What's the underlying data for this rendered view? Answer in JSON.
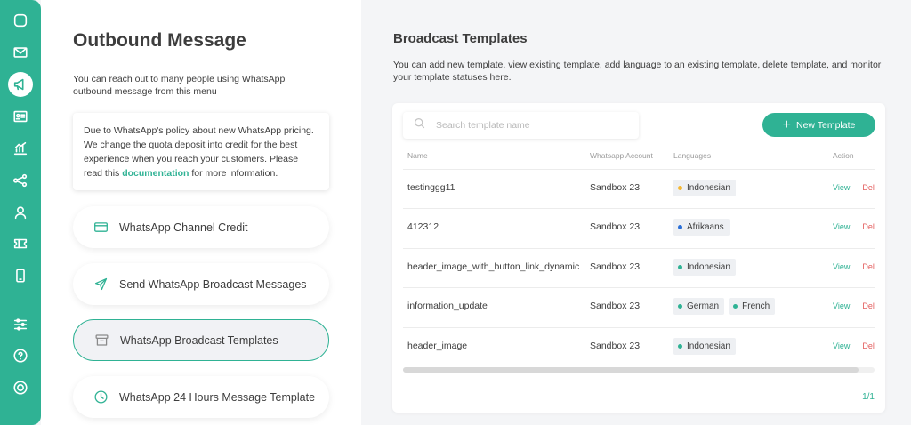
{
  "sidebar": {
    "icons": [
      "chat-icon",
      "mail-icon",
      "megaphone-icon",
      "contact-card-icon",
      "chart-icon",
      "share-icon",
      "user-icon",
      "ticket-icon",
      "mobile-icon",
      "sliders-icon",
      "help-icon",
      "power-icon"
    ],
    "active": "megaphone-icon"
  },
  "left": {
    "title": "Outbound Message",
    "description": "You can reach out to many people using WhatsApp outbound message from this menu",
    "notice_text": "Due to WhatsApp's policy about new WhatsApp pricing. We change the quota deposit into credit for the best experience when you reach your customers. Please read this ",
    "notice_link": "documentation",
    "notice_tail": " for more information.",
    "menu": [
      {
        "label": "WhatsApp Channel Credit",
        "icon": "credit-card-icon"
      },
      {
        "label": "Send WhatsApp Broadcast Messages",
        "icon": "send-icon"
      },
      {
        "label": "WhatsApp Broadcast Templates",
        "icon": "archive-icon",
        "selected": true
      },
      {
        "label": "WhatsApp 24 Hours Message Template",
        "icon": "clock-icon"
      }
    ]
  },
  "right": {
    "title": "Broadcast Templates",
    "description": "You can add new template, view existing template, add language to an existing template, delete template, and monitor your template statuses here.",
    "search_placeholder": "Search template name",
    "new_button": "New Template",
    "columns": {
      "name": "Name",
      "account": "Whatsapp Account",
      "languages": "Languages",
      "action": "Action"
    },
    "rows": [
      {
        "name": "testinggg11",
        "account": "Sandbox 23",
        "languages": [
          {
            "label": "Indonesian",
            "color": "#f5b731"
          }
        ]
      },
      {
        "name": "412312",
        "account": "Sandbox 23",
        "languages": [
          {
            "label": "Afrikaans",
            "color": "#2a6fd8"
          }
        ]
      },
      {
        "name": "header_image_with_button_link_dynamic",
        "account": "Sandbox 23",
        "languages": [
          {
            "label": "Indonesian",
            "color": "#2fb294"
          }
        ]
      },
      {
        "name": "information_update",
        "account": "Sandbox 23",
        "languages": [
          {
            "label": "German",
            "color": "#2fb294"
          },
          {
            "label": "French",
            "color": "#2fb294"
          }
        ]
      },
      {
        "name": "header_image",
        "account": "Sandbox 23",
        "languages": [
          {
            "label": "Indonesian",
            "color": "#2fb294"
          }
        ]
      }
    ],
    "action_view": "View",
    "action_del": "Del",
    "pagination": "1/1"
  },
  "colors": {
    "accent": "#2fb294",
    "danger": "#e35d5d"
  }
}
